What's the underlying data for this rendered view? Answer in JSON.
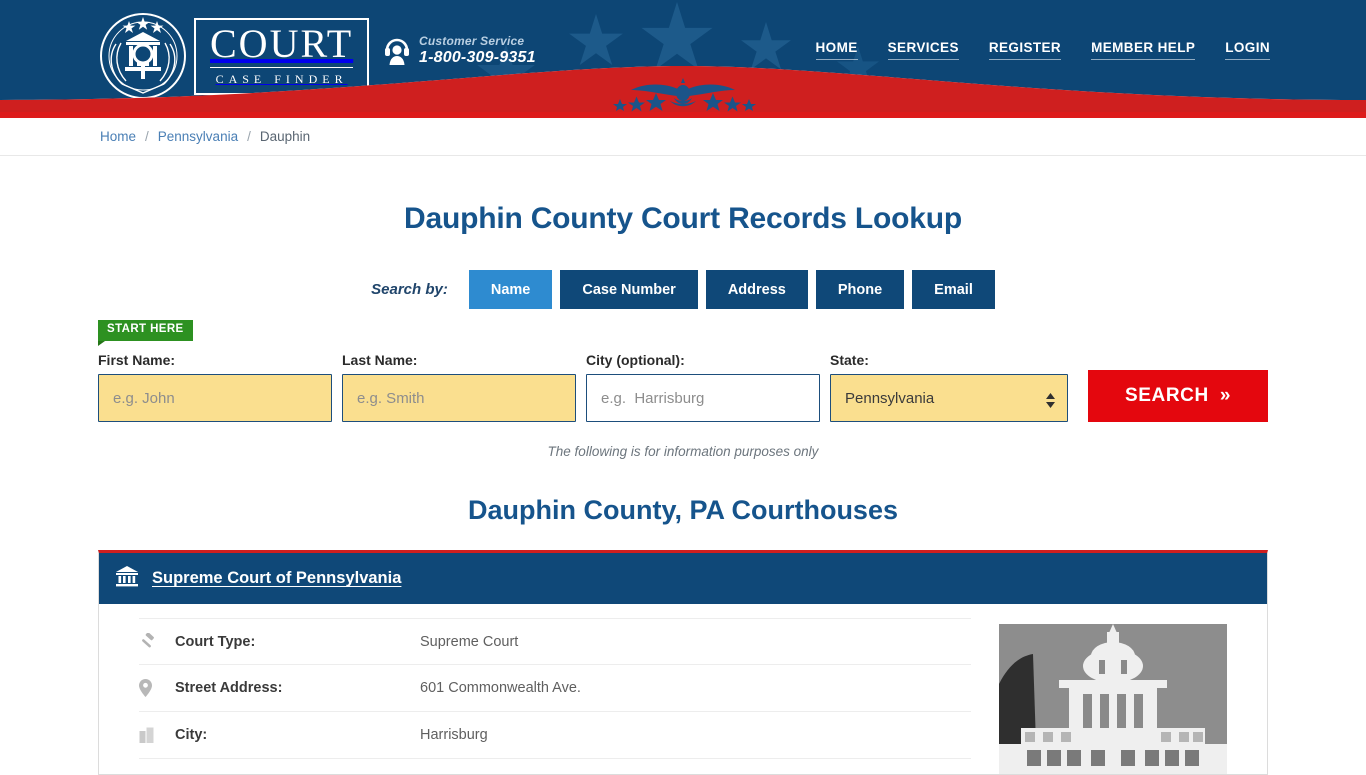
{
  "header": {
    "logo": {
      "main": "COURT",
      "sub": "CASE FINDER",
      "icon": "court-seal-icon"
    },
    "customer_service": {
      "label": "Customer Service",
      "phone": "1-800-309-9351",
      "icon": "headset-support-icon"
    },
    "nav": [
      {
        "label": "HOME"
      },
      {
        "label": "SERVICES"
      },
      {
        "label": "REGISTER"
      },
      {
        "label": "MEMBER HELP"
      },
      {
        "label": "LOGIN"
      }
    ],
    "colors": {
      "navy": "#0d4675",
      "red": "#dd1b1b",
      "star": "#1d5a8a"
    }
  },
  "breadcrumb": {
    "items": [
      {
        "label": "Home",
        "current": false
      },
      {
        "label": "Pennsylvania",
        "current": false
      },
      {
        "label": "Dauphin",
        "current": true
      }
    ],
    "separator": "/"
  },
  "main": {
    "page_title": "Dauphin County Court Records Lookup",
    "search_by_label": "Search by:",
    "tabs": [
      {
        "label": "Name",
        "active": true
      },
      {
        "label": "Case Number",
        "active": false
      },
      {
        "label": "Address",
        "active": false
      },
      {
        "label": "Phone",
        "active": false
      },
      {
        "label": "Email",
        "active": false
      }
    ],
    "start_here_badge": "START HERE",
    "form": {
      "first_name": {
        "label": "First Name:",
        "placeholder": "e.g. John",
        "value": "",
        "highlight": true
      },
      "last_name": {
        "label": "Last Name:",
        "placeholder": "e.g. Smith",
        "value": "",
        "highlight": true
      },
      "city": {
        "label": "City (optional):",
        "placeholder": "e.g.  Harrisburg",
        "value": "",
        "highlight": false
      },
      "state": {
        "label": "State:",
        "value": "Pennsylvania",
        "highlight": true,
        "options": [
          "Pennsylvania"
        ]
      },
      "search_button": {
        "label": "SEARCH",
        "chevron": "»",
        "color": "#e4070e"
      }
    },
    "disclaimer": "The following is for information purposes only",
    "section_title": "Dauphin County, PA Courthouses",
    "courts": [
      {
        "name": "Supreme Court of Pennsylvania",
        "icon": "bank-building-icon",
        "image": {
          "alt": "Pennsylvania State Capitol building",
          "icon": "capitol-photo"
        },
        "rows": [
          {
            "icon": "gavel-icon",
            "label": "Court Type:",
            "value": "Supreme Court"
          },
          {
            "icon": "map-pin-icon",
            "label": "Street Address:",
            "value": "601 Commonwealth Ave."
          },
          {
            "icon": "city-icon",
            "label": "City:",
            "value": "Harrisburg"
          }
        ]
      }
    ]
  }
}
